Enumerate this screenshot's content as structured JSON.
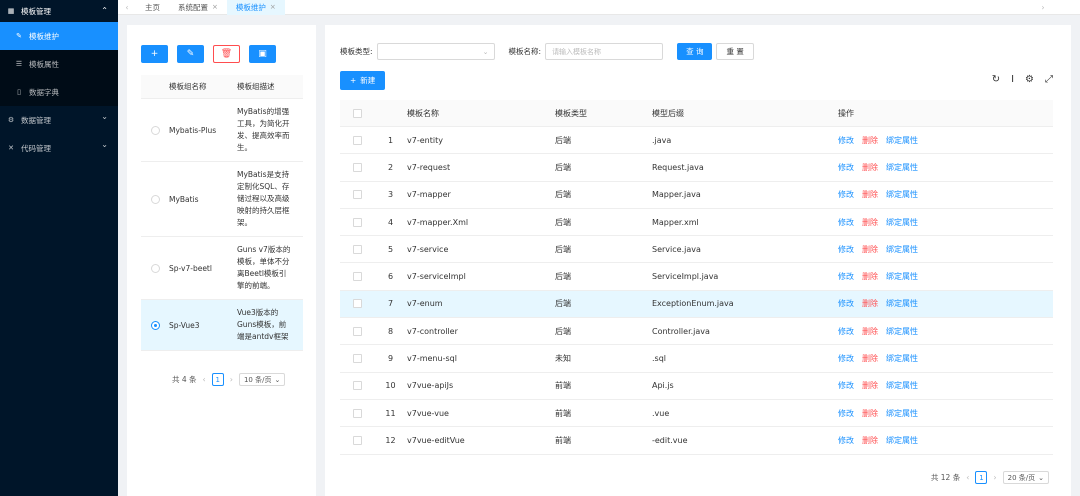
{
  "sidebar": {
    "group_template": "模板管理",
    "items": [
      {
        "label": "模板维护",
        "icon": "edit-icon",
        "active": true
      },
      {
        "label": "模板属性",
        "icon": "list-icon",
        "active": false
      },
      {
        "label": "数据字典",
        "icon": "book-icon",
        "active": false
      }
    ],
    "group_data": "数据管理",
    "group_code": "代码管理"
  },
  "tabs": [
    "主页",
    "系统配置",
    "模板维护"
  ],
  "left": {
    "headers": {
      "name": "模板组名称",
      "desc": "模板组描述"
    },
    "rows": [
      {
        "name": "Mybatis-Plus",
        "desc": "MyBatis的增强\n工具，为简化开\n发、提高效率而\n生。",
        "selected": false
      },
      {
        "name": "MyBatis",
        "desc": "MyBatis是支持\n定制化SQL、存\n储过程以及高级\n映射的持久层框\n架。",
        "selected": false
      },
      {
        "name": "Sp-v7-beetl",
        "desc": "Guns v7版本的\n模板，单体不分\n离Beetl模板引\n擎的前端。",
        "selected": false
      },
      {
        "name": "Sp-Vue3",
        "desc": "Vue3版本的\nGuns模板，前\n端是antdv框架",
        "selected": true
      }
    ],
    "pager": {
      "total": "共 4 条",
      "page": "1",
      "size": "10 条/页"
    }
  },
  "filter": {
    "type_label": "模板类型:",
    "name_label": "模板名称:",
    "name_placeholder": "请输入模板名称",
    "search": "查 询",
    "reset": "重 置"
  },
  "new_button": "新建",
  "table": {
    "headers": {
      "name": "模板名称",
      "type": "模板类型",
      "suffix": "模型后缀",
      "op": "操作"
    },
    "ops": {
      "edit": "修改",
      "del": "删除",
      "bind": "绑定属性"
    },
    "rows": [
      {
        "idx": "1",
        "name": "v7-entity",
        "type": "后端",
        "suffix": ".java"
      },
      {
        "idx": "2",
        "name": "v7-request",
        "type": "后端",
        "suffix": "Request.java"
      },
      {
        "idx": "3",
        "name": "v7-mapper",
        "type": "后端",
        "suffix": "Mapper.java"
      },
      {
        "idx": "4",
        "name": "v7-mapper.Xml",
        "type": "后端",
        "suffix": "Mapper.xml"
      },
      {
        "idx": "5",
        "name": "v7-service",
        "type": "后端",
        "suffix": "Service.java"
      },
      {
        "idx": "6",
        "name": "v7-serviceImpl",
        "type": "后端",
        "suffix": "ServiceImpl.java"
      },
      {
        "idx": "7",
        "name": "v7-enum",
        "type": "后端",
        "suffix": "ExceptionEnum.java"
      },
      {
        "idx": "8",
        "name": "v7-controller",
        "type": "后端",
        "suffix": "Controller.java"
      },
      {
        "idx": "9",
        "name": "v7-menu-sql",
        "type": "未知",
        "suffix": ".sql"
      },
      {
        "idx": "10",
        "name": "v7vue-apiJs",
        "type": "前端",
        "suffix": "Api.js"
      },
      {
        "idx": "11",
        "name": "v7vue-vue",
        "type": "前端",
        "suffix": ".vue"
      },
      {
        "idx": "12",
        "name": "v7vue-editVue",
        "type": "前端",
        "suffix": "-edit.vue"
      }
    ],
    "pager": {
      "total": "共 12 条",
      "page": "1",
      "size": "20 条/页"
    }
  }
}
